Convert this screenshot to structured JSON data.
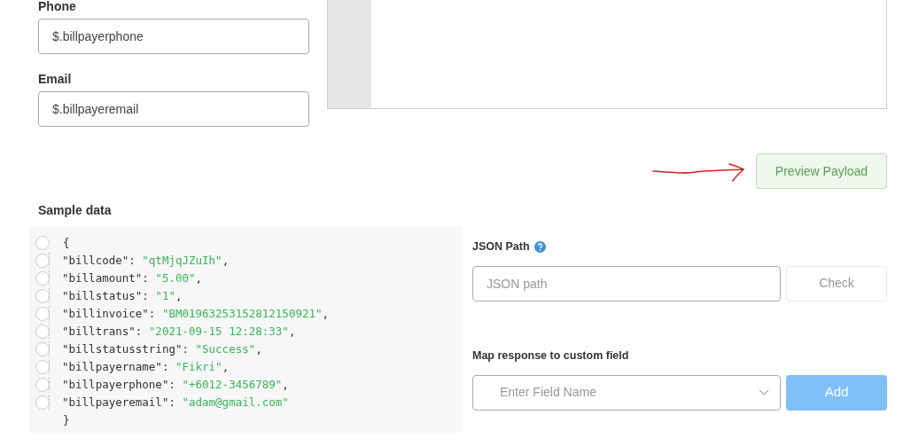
{
  "fields": [
    {
      "label": "Phone",
      "value": "$.billpayerphone"
    },
    {
      "label": "Email",
      "value": "$.billpayeremail"
    }
  ],
  "preview_button": {
    "label": "Preview Payload"
  },
  "sample_data": {
    "title": "Sample data",
    "lines": [
      {
        "kind": "open",
        "text": "{",
        "selected": false
      },
      {
        "kind": "pair",
        "key": "\"billcode\":",
        "value": "\"qtMjqJZuIh\"",
        "comma": ",",
        "selected": false
      },
      {
        "kind": "pair",
        "key": "\"billamount\":",
        "value": "\"5.00\"",
        "comma": ",",
        "selected": false
      },
      {
        "kind": "pair",
        "key": "\"billstatus\":",
        "value": "\"1\"",
        "comma": ",",
        "selected": false
      },
      {
        "kind": "pair",
        "key": "\"billinvoice\":",
        "value": "\"BM01963253152812150921\"",
        "comma": ",",
        "selected": false
      },
      {
        "kind": "pair",
        "key": "\"billtrans\":",
        "value": "\"2021-09-15 12:28:33\"",
        "comma": ",",
        "selected": false
      },
      {
        "kind": "pair",
        "key": "\"billstatusstring\":",
        "value": "\"Success\"",
        "comma": ",",
        "selected": false
      },
      {
        "kind": "pair",
        "key": "\"billpayername\":",
        "value": "\"Fikri\"",
        "comma": ",",
        "selected": false
      },
      {
        "kind": "pair",
        "key": "\"billpayerphone\":",
        "value": "\"+6012-3456789\"",
        "comma": ",",
        "selected": false
      },
      {
        "kind": "pair",
        "key": "\"billpayeremail\":",
        "value": "\"adam@gmail.com\"",
        "selected": false
      },
      {
        "kind": "close",
        "text": "}"
      }
    ]
  },
  "json_path": {
    "label": "JSON Path",
    "placeholder": "JSON path",
    "button": {
      "label": "Check",
      "disabled": true
    }
  },
  "map_field": {
    "label": "Map response to custom field",
    "placeholder": "Enter Field Name",
    "button": {
      "label": "Add",
      "disabled": true
    }
  }
}
